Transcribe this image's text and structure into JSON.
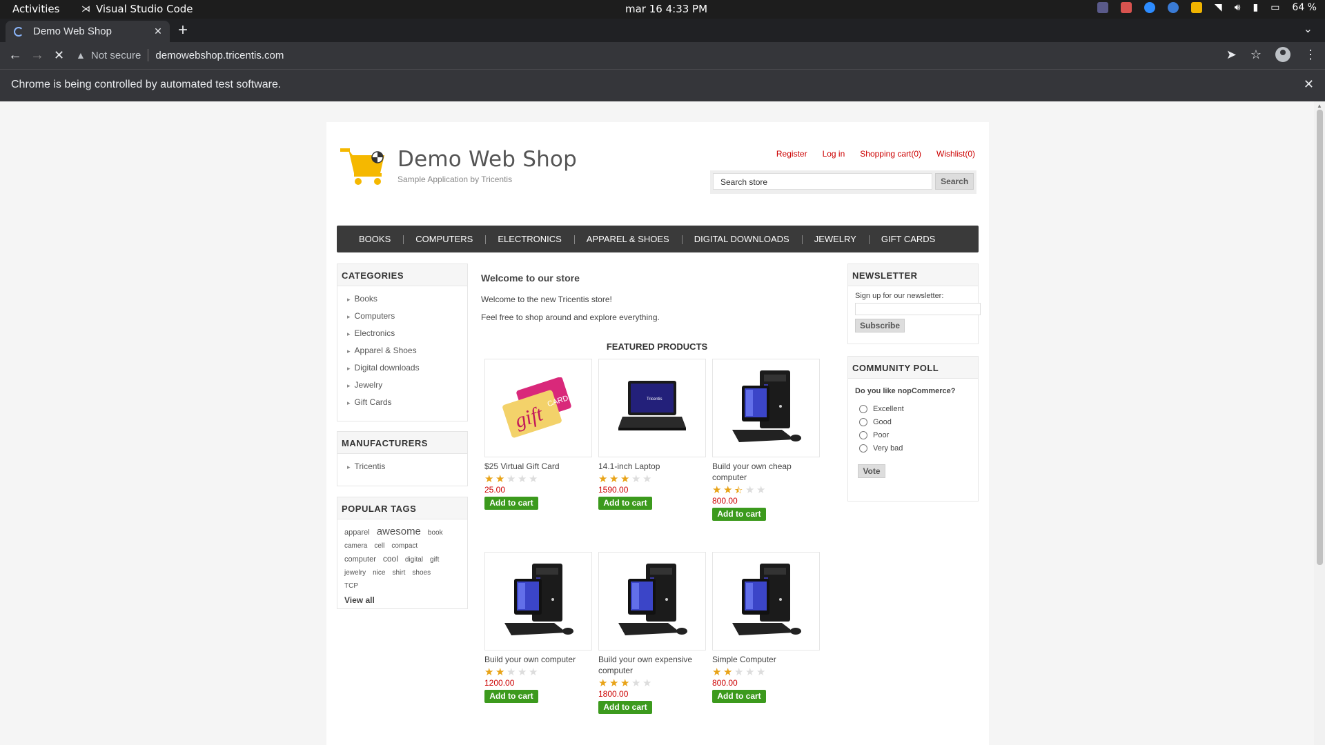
{
  "os": {
    "activities": "Activities",
    "app_name": "Visual Studio Code",
    "clock": "mar 16  4:33 PM",
    "battery": "64 %"
  },
  "browser": {
    "tab_title": "Demo Web Shop",
    "new_tab": "+",
    "security_label": "Not secure",
    "url": "demowebshop.tricentis.com",
    "infobar_message": "Chrome is being controlled by automated test software."
  },
  "site": {
    "logo_title": "Demo Web Shop",
    "logo_subtitle": "Sample Application by Tricentis",
    "header_links": {
      "register": "Register",
      "login": "Log in",
      "cart": "Shopping cart(0)",
      "wishlist": "Wishlist(0)"
    },
    "search": {
      "value": "Search store",
      "button": "Search"
    },
    "menu": [
      "BOOKS",
      "COMPUTERS",
      "ELECTRONICS",
      "APPAREL & SHOES",
      "DIGITAL DOWNLOADS",
      "JEWELRY",
      "GIFT CARDS"
    ],
    "categories": {
      "title": "CATEGORIES",
      "items": [
        "Books",
        "Computers",
        "Electronics",
        "Apparel & Shoes",
        "Digital downloads",
        "Jewelry",
        "Gift Cards"
      ]
    },
    "manufacturers": {
      "title": "MANUFACTURERS",
      "items": [
        "Tricentis"
      ]
    },
    "popular_tags": {
      "title": "POPULAR TAGS",
      "tags": [
        "apparel",
        "awesome",
        "book",
        "camera",
        "cell",
        "compact",
        "computer",
        "cool",
        "digital",
        "gift",
        "jewelry",
        "nice",
        "shirt",
        "shoes",
        "TCP"
      ],
      "view_all": "View all"
    },
    "welcome": {
      "title": "Welcome to our store",
      "line1": "Welcome to the new Tricentis store!",
      "line2": "Feel free to shop around and explore everything."
    },
    "featured_title": "FEATURED PRODUCTS",
    "add_to_cart": "Add to cart",
    "products": [
      {
        "name": "$25 Virtual Gift Card",
        "price": "25.00",
        "rating": 2,
        "image": "gift-card"
      },
      {
        "name": "14.1-inch Laptop",
        "price": "1590.00",
        "rating": 3,
        "image": "laptop"
      },
      {
        "name": "Build your own cheap computer",
        "price": "800.00",
        "rating": 2.5,
        "image": "desktop"
      },
      {
        "name": "Build your own computer",
        "price": "1200.00",
        "rating": 2,
        "image": "desktop"
      },
      {
        "name": "Build your own expensive computer",
        "price": "1800.00",
        "rating": 3,
        "image": "desktop"
      },
      {
        "name": "Simple Computer",
        "price": "800.00",
        "rating": 2,
        "image": "desktop"
      }
    ],
    "newsletter": {
      "title": "NEWSLETTER",
      "label": "Sign up for our newsletter:",
      "button": "Subscribe"
    },
    "poll": {
      "title": "COMMUNITY POLL",
      "question": "Do you like nopCommerce?",
      "options": [
        "Excellent",
        "Good",
        "Poor",
        "Very bad"
      ],
      "button": "Vote"
    }
  },
  "colors": {
    "link": "#cc0000",
    "cart_button": "#3c9a1d",
    "menu_bg": "#3a3a3a",
    "star": "#e8a317"
  }
}
